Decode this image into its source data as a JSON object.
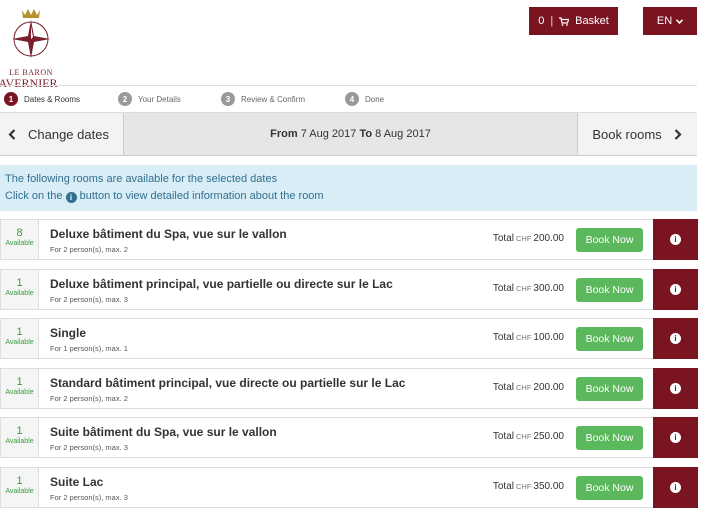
{
  "brand": {
    "logo_line1": "LE BARON",
    "logo_line2": "AVERNIER",
    "accent": "#7a1421"
  },
  "header": {
    "basket_count": "0",
    "basket_label": "Basket",
    "lang_label": "EN"
  },
  "steps": [
    {
      "num": "1",
      "label": "Dates & Rooms",
      "active": true
    },
    {
      "num": "2",
      "label": "Your Details",
      "active": false
    },
    {
      "num": "3",
      "label": "Review & Confirm",
      "active": false
    },
    {
      "num": "4",
      "label": "Done",
      "active": false
    }
  ],
  "datebar": {
    "change_label": "Change dates",
    "from_label": "From",
    "from_date": "7 Aug 2017",
    "to_label": "To",
    "to_date": "8 Aug 2017",
    "book_label": "Book rooms"
  },
  "info": {
    "line1": "The following rooms are available for the selected dates",
    "line2_prefix": "Click on the",
    "line2_suffix": "button to view detailed information about the room"
  },
  "rooms": [
    {
      "available": "8",
      "available_label": "Available",
      "name": "Deluxe bâtiment du Spa, vue sur le vallon",
      "occupancy": "For 2 person(s), max. 2",
      "total_label": "Total",
      "currency": "CHF",
      "price": "200.00",
      "book_label": "Book Now"
    },
    {
      "available": "1",
      "available_label": "Available",
      "name": "Deluxe bâtiment principal, vue partielle ou directe sur le Lac",
      "occupancy": "For 2 person(s), max. 3",
      "total_label": "Total",
      "currency": "CHF",
      "price": "300.00",
      "book_label": "Book Now"
    },
    {
      "available": "1",
      "available_label": "Available",
      "name": "Single",
      "occupancy": "For 1 person(s), max. 1",
      "total_label": "Total",
      "currency": "CHF",
      "price": "100.00",
      "book_label": "Book Now"
    },
    {
      "available": "1",
      "available_label": "Available",
      "name": "Standard bâtiment principal, vue directe ou partielle sur le Lac",
      "occupancy": "For 2 person(s), max. 2",
      "total_label": "Total",
      "currency": "CHF",
      "price": "200.00",
      "book_label": "Book Now"
    },
    {
      "available": "1",
      "available_label": "Available",
      "name": "Suite bâtiment du Spa, vue sur le vallon",
      "occupancy": "For 2 person(s), max. 3",
      "total_label": "Total",
      "currency": "CHF",
      "price": "250.00",
      "book_label": "Book Now"
    },
    {
      "available": "1",
      "available_label": "Available",
      "name": "Suite Lac",
      "occupancy": "For 2 person(s), max. 3",
      "total_label": "Total",
      "currency": "CHF",
      "price": "350.00",
      "book_label": "Book Now"
    }
  ]
}
